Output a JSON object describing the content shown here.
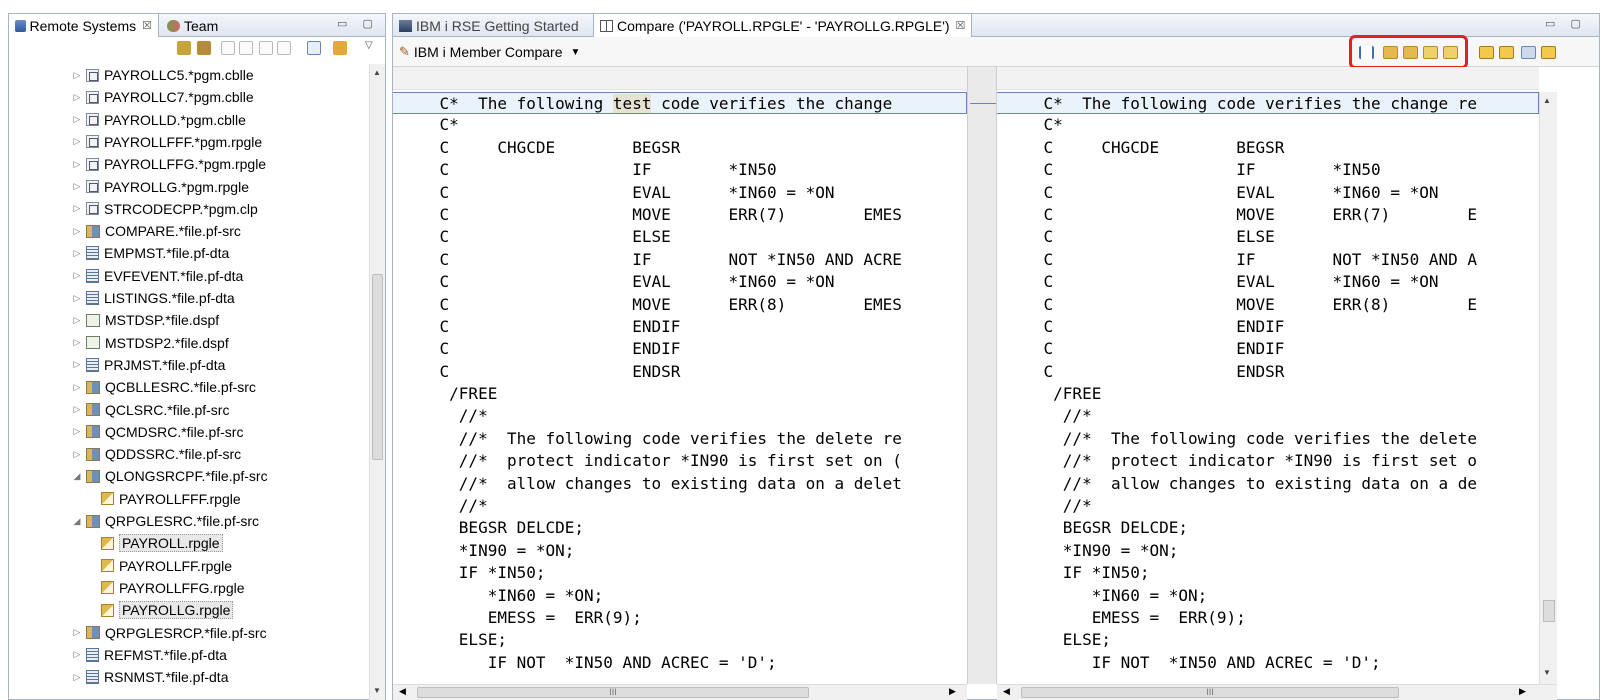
{
  "left_view": {
    "tabs": [
      {
        "label": "Remote Systems",
        "close": "☒"
      },
      {
        "label": "Team"
      }
    ],
    "window_controls": "▭ ▢",
    "tree_items": [
      {
        "label": "PAYROLLC5.*pgm.cblle",
        "icon": "pgm",
        "twisty": "▷"
      },
      {
        "label": "PAYROLLC7.*pgm.cblle",
        "icon": "pgm",
        "twisty": "▷"
      },
      {
        "label": "PAYROLLD.*pgm.cblle",
        "icon": "pgm",
        "twisty": "▷"
      },
      {
        "label": "PAYROLLFFF.*pgm.rpgle",
        "icon": "pgm",
        "twisty": "▷"
      },
      {
        "label": "PAYROLLFFG.*pgm.rpgle",
        "icon": "pgm",
        "twisty": "▷"
      },
      {
        "label": "PAYROLLG.*pgm.rpgle",
        "icon": "pgm",
        "twisty": "▷"
      },
      {
        "label": "STRCODECPP.*pgm.clp",
        "icon": "pgm",
        "twisty": "▷"
      },
      {
        "label": "COMPARE.*file.pf-src",
        "icon": "src",
        "twisty": "▷"
      },
      {
        "label": "EMPMST.*file.pf-dta",
        "icon": "dta",
        "twisty": "▷"
      },
      {
        "label": "EVFEVENT.*file.pf-dta",
        "icon": "dta",
        "twisty": "▷"
      },
      {
        "label": "LISTINGS.*file.pf-dta",
        "icon": "dta",
        "twisty": "▷"
      },
      {
        "label": "MSTDSP.*file.dspf",
        "icon": "dspf",
        "twisty": "▷"
      },
      {
        "label": "MSTDSP2.*file.dspf",
        "icon": "dspf",
        "twisty": "▷"
      },
      {
        "label": "PRJMST.*file.pf-dta",
        "icon": "dta",
        "twisty": "▷"
      },
      {
        "label": "QCBLLESRC.*file.pf-src",
        "icon": "src",
        "twisty": "▷"
      },
      {
        "label": "QCLSRC.*file.pf-src",
        "icon": "src",
        "twisty": "▷"
      },
      {
        "label": "QCMDSRC.*file.pf-src",
        "icon": "src",
        "twisty": "▷"
      },
      {
        "label": "QDDSSRC.*file.pf-src",
        "icon": "src",
        "twisty": "▷"
      },
      {
        "label": "QLONGSRCPF.*file.pf-src",
        "icon": "src",
        "twisty": "◢"
      },
      {
        "label": "PAYROLLFFF.rpgle",
        "icon": "mbr",
        "twisty": ""
      },
      {
        "label": "QRPGLESRC.*file.pf-src",
        "icon": "src",
        "twisty": "◢"
      },
      {
        "label": "PAYROLL.rpgle",
        "icon": "mbr",
        "twisty": "",
        "selected": true
      },
      {
        "label": "PAYROLLFF.rpgle",
        "icon": "mbr",
        "twisty": ""
      },
      {
        "label": "PAYROLLFFG.rpgle",
        "icon": "mbr",
        "twisty": ""
      },
      {
        "label": "PAYROLLG.rpgle",
        "icon": "mbr",
        "twisty": "",
        "selected": true
      },
      {
        "label": "QRPGLESRCP.*file.pf-src",
        "icon": "src",
        "twisty": "▷"
      },
      {
        "label": "REFMST.*file.pf-dta",
        "icon": "dta",
        "twisty": "▷"
      },
      {
        "label": "RSNMST.*file.pf-dta",
        "icon": "dta",
        "twisty": "▷"
      }
    ]
  },
  "editor": {
    "tabs": [
      {
        "label": "IBM i RSE Getting Started"
      },
      {
        "label": "Compare ('PAYROLL.RPGLE' - 'PAYROLLG.RPGLE')",
        "close": "☒"
      }
    ],
    "window_controls": "▭ ▢",
    "compare_title": "IBM i Member Compare",
    "left_lines": [
      "    C*  The following test code verifies the change ",
      "    C*",
      "    C     CHGCDE        BEGSR",
      "    C                   IF        *IN50",
      "    C                   EVAL      *IN60 = *ON",
      "    C                   MOVE      ERR(7)        EMES",
      "    C                   ELSE",
      "    C                   IF        NOT *IN50 AND ACRE",
      "    C                   EVAL      *IN60 = *ON",
      "    C                   MOVE      ERR(8)        EMES",
      "    C                   ENDIF",
      "    C                   ENDIF",
      "    C                   ENDSR",
      "     /FREE",
      "      //*",
      "      //*  The following code verifies the delete re",
      "      //*  protect indicator *IN90 is first set on (",
      "      //*  allow changes to existing data on a delet",
      "      //*",
      "      BEGSR DELCDE;",
      "      *IN90 = *ON;",
      "      IF *IN50;",
      "         *IN60 = *ON;",
      "         EMESS =  ERR(9);",
      "      ELSE;",
      "         IF NOT  *IN50 AND ACREC = 'D';"
    ],
    "right_lines": [
      "    C*  The following code verifies the change re",
      "    C*",
      "    C     CHGCDE        BEGSR",
      "    C                   IF        *IN50",
      "    C                   EVAL      *IN60 = *ON",
      "    C                   MOVE      ERR(7)        E",
      "    C                   ELSE",
      "    C                   IF        NOT *IN50 AND A",
      "    C                   EVAL      *IN60 = *ON",
      "    C                   MOVE      ERR(8)        E",
      "    C                   ENDIF",
      "    C                   ENDIF",
      "    C                   ENDSR",
      "     /FREE",
      "      //*",
      "      //*  The following code verifies the delete",
      "      //*  protect indicator *IN90 is first set o",
      "      //*  allow changes to existing data on a de",
      "      //*",
      "      BEGSR DELCDE;",
      "      *IN90 = *ON;",
      "      IF *IN50;",
      "         *IN60 = *ON;",
      "         EMESS =  ERR(9);",
      "      ELSE;",
      "         IF NOT  *IN50 AND ACREC = 'D';"
    ],
    "scroll_grip": "III"
  },
  "colors": {
    "highlight_box": "#e0211e",
    "changed_line_bg": "#eaf3fb",
    "diff_word_bg": "#e6e2d2"
  }
}
